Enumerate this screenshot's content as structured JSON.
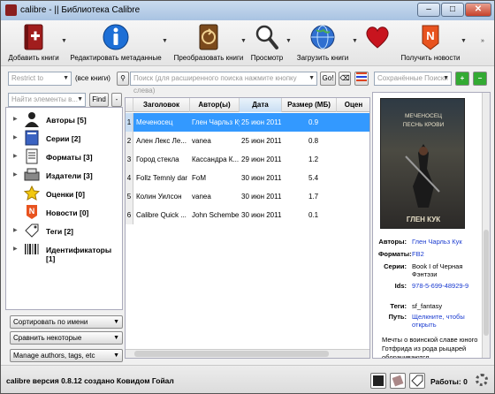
{
  "window": {
    "title": "calibre - || Библиотека Calibre",
    "minimize": "–",
    "maximize": "□",
    "close": "✕"
  },
  "toolbar": {
    "items": [
      {
        "label": "Добавить книги",
        "icon": "add-book-icon"
      },
      {
        "label": "Редактировать метаданные",
        "icon": "info-icon"
      },
      {
        "label": "Преобразовать книги",
        "icon": "convert-book-icon"
      },
      {
        "label": "Просмотр",
        "icon": "magnifier-icon"
      },
      {
        "label": "Загрузить книги",
        "icon": "globe-icon"
      },
      {
        "label": "",
        "icon": "heart-icon"
      },
      {
        "label": "Получить новости",
        "icon": "news-icon"
      }
    ]
  },
  "search_row": {
    "restrict_placeholder": "Restrict to",
    "books_count": "(все книги)",
    "search_placeholder": "Поиск (для расширенного поиска нажмите кнопку слева)",
    "go_label": "Go!",
    "saved_searches_placeholder": "Сохранённые Поиски"
  },
  "tag_browser": {
    "find_placeholder": "Найти элементы в...",
    "find_label": "Find",
    "minus_label": "-",
    "categories": [
      {
        "label": "Авторы [5]",
        "icon": "authors-icon"
      },
      {
        "label": "Серии [2]",
        "icon": "series-icon"
      },
      {
        "label": "Форматы [3]",
        "icon": "formats-icon"
      },
      {
        "label": "Издатели [3]",
        "icon": "publishers-icon"
      },
      {
        "label": "Оценки [0]",
        "icon": "rating-star-icon"
      },
      {
        "label": "Новости [0]",
        "icon": "news-icon"
      },
      {
        "label": "Теги [2]",
        "icon": "tags-icon"
      },
      {
        "label": "Идентификаторы [1]",
        "icon": "barcode-icon"
      }
    ],
    "sort_label": "Сортировать по имени",
    "match_label": "Сравнить некоторые",
    "manage_label": "Manage authors, tags, etc"
  },
  "book_list": {
    "columns": [
      "Заголовок",
      "Автор(ы)",
      "Дата",
      "Размер (МБ)",
      "Оцен"
    ],
    "rows": [
      {
        "num": "1",
        "title": "Меченосец",
        "author": "Глен Чарльз Кук",
        "date": "25 июн 2011",
        "size": "0.9"
      },
      {
        "num": "2",
        "title": "Ален Лекс Ле...",
        "author": "vanea",
        "date": "25 июн 2011",
        "size": "0.8"
      },
      {
        "num": "3",
        "title": "Город стекла",
        "author": "Кассандра К...",
        "date": "29 июн 2011",
        "size": "1.2"
      },
      {
        "num": "4",
        "title": "Follz Temniy dar",
        "author": "FoM",
        "date": "30 июн 2011",
        "size": "5.4"
      },
      {
        "num": "5",
        "title": "Колин Уилсон",
        "author": "vanea",
        "date": "30 июн 2011",
        "size": "1.7"
      },
      {
        "num": "6",
        "title": "Calibre Quick ...",
        "author": "John Schember",
        "date": "30 июн 2011",
        "size": "0.1"
      }
    ]
  },
  "details": {
    "cover_title_line1": "МЕЧЕНОСЕЦ",
    "cover_title_line2": "ПЕСНЬ КРОВИ",
    "cover_author": "ГЛЕН КУК",
    "fields": [
      {
        "key": "Авторы:",
        "value": "Глен Чарльз Кук",
        "link": true
      },
      {
        "key": "Форматы:",
        "value": "FB2",
        "link": true
      },
      {
        "key": "Серии:",
        "value": "Book I of Черная Фэнтэзи",
        "link": false
      },
      {
        "key": "Ids:",
        "value": "978-5-699-48929-9",
        "link": true
      },
      {
        "key": "Теги:",
        "value": "sf_fantasy",
        "link": false
      },
      {
        "key": "Путь:",
        "value": "Щелкните, чтобы открыть",
        "link": true
      }
    ],
    "description": "Мечты о воинской славе юного Готфрида из рода рыцарей оборачиваются"
  },
  "status": {
    "text": "calibre версия 0.8.12 создано Ковидом Гойал",
    "jobs_label": "Работы: 0"
  }
}
